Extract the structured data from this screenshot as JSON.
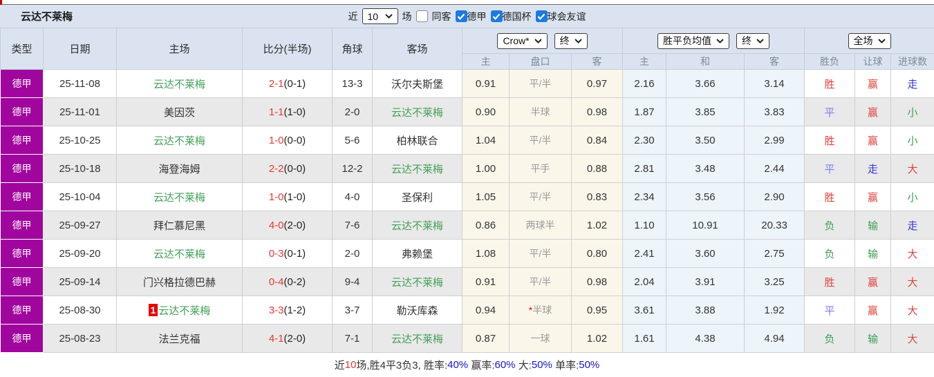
{
  "colors": {
    "accent_purple": "#a0059d",
    "team_green": "#43a058",
    "score_red": "#e8392f",
    "checkbox_blue": "#1b7ae0",
    "header_blue": "#dae3ef",
    "handicap_tint": "#fbf6ea",
    "europe_tint": "#edf4fa"
  },
  "title_bar": {
    "team_name": "云达不莱梅",
    "recent_label": "近",
    "recent_value": "10",
    "matches_label": "场",
    "same_away_label": "同客",
    "same_away_checked": false,
    "leagues": [
      {
        "label": "德甲",
        "checked": true
      },
      {
        "label": "德国杯",
        "checked": true
      },
      {
        "label": "球会友谊",
        "checked": true
      }
    ]
  },
  "table": {
    "selects": {
      "company": "Crow*",
      "company_time": "终",
      "avg": "胜平负均值",
      "avg_time": "终",
      "scope": "全场"
    },
    "columns": {
      "type": "类型",
      "date": "日期",
      "home": "主场",
      "score": "比分(半场)",
      "corners": "角球",
      "away": "客场",
      "ah_home": "主",
      "ah_line": "盘口",
      "ah_away": "客",
      "eu_home": "主",
      "eu_draw": "和",
      "eu_away": "客",
      "result": "胜负",
      "handicap": "让球",
      "goals": "进球数"
    },
    "rows": [
      {
        "league": "德甲",
        "date": "25-11-08",
        "home_badge": "",
        "home": "云达不莱梅",
        "home_self": "yes",
        "score": "2-1",
        "half": "(0-1)",
        "corners": "13-3",
        "away": "沃尔夫斯堡",
        "away_self": "no",
        "ah_home": "0.91",
        "line_star": "",
        "line": "平/半",
        "ah_away": "0.97",
        "eu_home": "2.16",
        "eu_draw": "3.66",
        "eu_away": "3.14",
        "result": "胜",
        "result_c": "red",
        "let": "赢",
        "let_c": "red",
        "goal": "走",
        "goal_c": "blue"
      },
      {
        "league": "德甲",
        "date": "25-11-01",
        "home_badge": "",
        "home": "美因茨",
        "home_self": "no",
        "score": "1-1",
        "half": "(1-0)",
        "corners": "2-0",
        "away": "云达不莱梅",
        "away_self": "yes",
        "ah_home": "0.90",
        "line_star": "",
        "line": "半球",
        "ah_away": "0.98",
        "eu_home": "1.87",
        "eu_draw": "3.85",
        "eu_away": "3.83",
        "result": "平",
        "result_c": "lblue",
        "let": "赢",
        "let_c": "red",
        "goal": "小",
        "goal_c": "green"
      },
      {
        "league": "德甲",
        "date": "25-10-25",
        "home_badge": "",
        "home": "云达不莱梅",
        "home_self": "yes",
        "score": "1-0",
        "half": "(0-0)",
        "corners": "5-6",
        "away": "柏林联合",
        "away_self": "no",
        "ah_home": "1.04",
        "line_star": "",
        "line": "平/半",
        "ah_away": "0.84",
        "eu_home": "2.30",
        "eu_draw": "3.50",
        "eu_away": "2.99",
        "result": "胜",
        "result_c": "red",
        "let": "赢",
        "let_c": "red",
        "goal": "小",
        "goal_c": "green"
      },
      {
        "league": "德甲",
        "date": "25-10-18",
        "home_badge": "",
        "home": "海登海姆",
        "home_self": "no",
        "score": "2-2",
        "half": "(0-0)",
        "corners": "12-2",
        "away": "云达不莱梅",
        "away_self": "yes",
        "ah_home": "1.00",
        "line_star": "",
        "line": "平手",
        "ah_away": "0.88",
        "eu_home": "2.81",
        "eu_draw": "3.48",
        "eu_away": "2.44",
        "result": "平",
        "result_c": "lblue",
        "let": "走",
        "let_c": "blue",
        "goal": "大",
        "goal_c": "red"
      },
      {
        "league": "德甲",
        "date": "25-10-04",
        "home_badge": "",
        "home": "云达不莱梅",
        "home_self": "yes",
        "score": "1-0",
        "half": "(1-0)",
        "corners": "4-0",
        "away": "圣保利",
        "away_self": "no",
        "ah_home": "1.05",
        "line_star": "",
        "line": "平/半",
        "ah_away": "0.83",
        "eu_home": "2.34",
        "eu_draw": "3.56",
        "eu_away": "2.90",
        "result": "胜",
        "result_c": "red",
        "let": "赢",
        "let_c": "red",
        "goal": "小",
        "goal_c": "green"
      },
      {
        "league": "德甲",
        "date": "25-09-27",
        "home_badge": "",
        "home": "拜仁慕尼黑",
        "home_self": "no",
        "score": "4-0",
        "half": "(2-0)",
        "corners": "7-6",
        "away": "云达不莱梅",
        "away_self": "yes",
        "ah_home": "0.86",
        "line_star": "",
        "line": "两球半",
        "ah_away": "1.02",
        "eu_home": "1.10",
        "eu_draw": "10.91",
        "eu_away": "20.33",
        "result": "负",
        "result_c": "green",
        "let": "输",
        "let_c": "green",
        "goal": "走",
        "goal_c": "blue"
      },
      {
        "league": "德甲",
        "date": "25-09-20",
        "home_badge": "",
        "home": "云达不莱梅",
        "home_self": "yes",
        "score": "0-3",
        "half": "(0-1)",
        "corners": "2-0",
        "away": "弗赖堡",
        "away_self": "no",
        "ah_home": "1.08",
        "line_star": "",
        "line": "平/半",
        "ah_away": "0.80",
        "eu_home": "2.41",
        "eu_draw": "3.60",
        "eu_away": "2.75",
        "result": "负",
        "result_c": "green",
        "let": "输",
        "let_c": "green",
        "goal": "大",
        "goal_c": "red"
      },
      {
        "league": "德甲",
        "date": "25-09-14",
        "home_badge": "",
        "home": "门兴格拉德巴赫",
        "home_self": "no",
        "score": "0-4",
        "half": "(0-2)",
        "corners": "9-4",
        "away": "云达不莱梅",
        "away_self": "yes",
        "ah_home": "0.91",
        "line_star": "",
        "line": "平/半",
        "ah_away": "0.98",
        "eu_home": "2.04",
        "eu_draw": "3.91",
        "eu_away": "3.25",
        "result": "胜",
        "result_c": "red",
        "let": "赢",
        "let_c": "red",
        "goal": "大",
        "goal_c": "red"
      },
      {
        "league": "德甲",
        "date": "25-08-30",
        "home_badge": "1",
        "home": "云达不莱梅",
        "home_self": "yes",
        "score": "3-3",
        "half": "(1-2)",
        "corners": "3-7",
        "away": "勒沃库森",
        "away_self": "no",
        "ah_home": "0.94",
        "line_star": "*",
        "line": "半球",
        "ah_away": "0.95",
        "eu_home": "3.61",
        "eu_draw": "3.88",
        "eu_away": "1.92",
        "result": "平",
        "result_c": "lblue",
        "let": "赢",
        "let_c": "red",
        "goal": "大",
        "goal_c": "red"
      },
      {
        "league": "德甲",
        "date": "25-08-23",
        "home_badge": "",
        "home": "法兰克福",
        "home_self": "no",
        "score": "4-1",
        "half": "(2-0)",
        "corners": "7-1",
        "away": "云达不莱梅",
        "away_self": "yes",
        "ah_home": "0.87",
        "line_star": "",
        "line": "一球",
        "ah_away": "1.02",
        "eu_home": "1.61",
        "eu_draw": "4.38",
        "eu_away": "4.94",
        "result": "负",
        "result_c": "green",
        "let": "输",
        "let_c": "green",
        "goal": "大",
        "goal_c": "red"
      }
    ]
  },
  "footer": {
    "prefix": "近",
    "count": "10",
    "record": "场,胜4平3负3, 胜率:",
    "win_rate": "40%",
    "handicap_label": " 赢率:",
    "handicap_rate": "60%",
    "big_label": " 大:",
    "big_rate": "50%",
    "odd_label": " 单率:",
    "odd_rate": "50%"
  }
}
